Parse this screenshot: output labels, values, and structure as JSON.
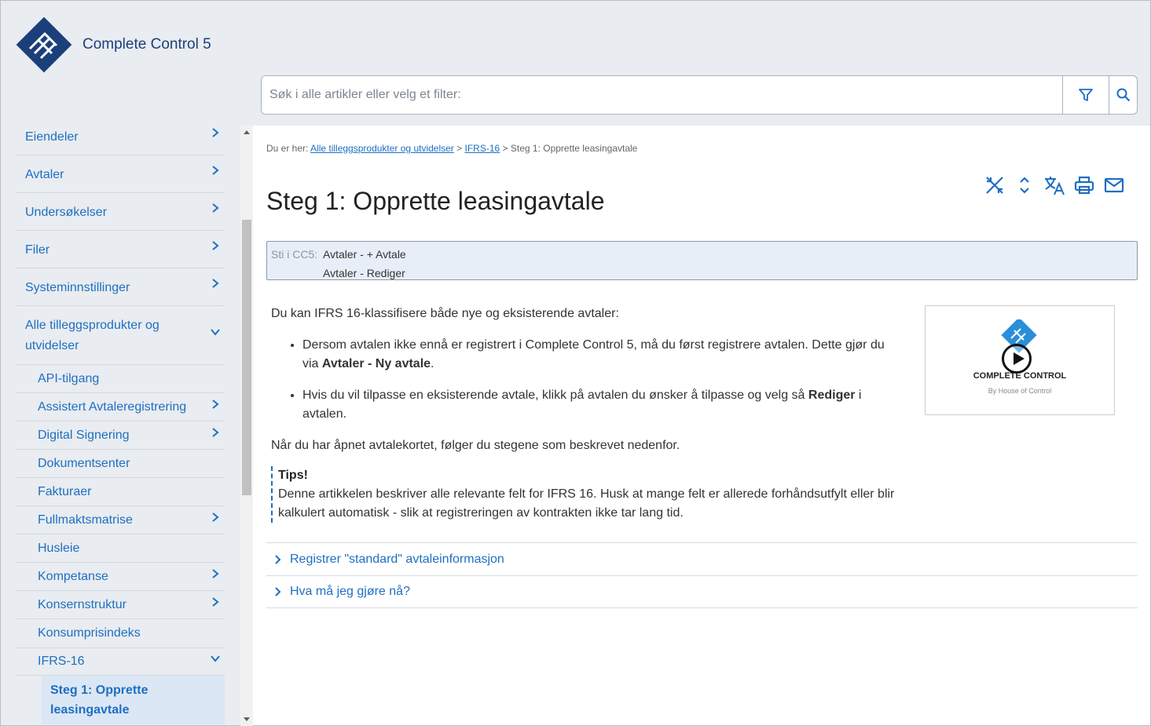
{
  "app": {
    "title": "Complete Control 5"
  },
  "search": {
    "placeholder": "Søk i alle artikler eller velg et filter:"
  },
  "sidebar": {
    "items": [
      {
        "label": "Eiendeler"
      },
      {
        "label": "Avtaler"
      },
      {
        "label": "Undersøkelser"
      },
      {
        "label": "Filer"
      },
      {
        "label": "Systeminnstillinger"
      },
      {
        "label": "Alle tilleggsprodukter og utvidelser"
      },
      {
        "label": "API-tilgang"
      },
      {
        "label": "Assistert Avtaleregistrering"
      },
      {
        "label": "Digital Signering"
      },
      {
        "label": "Dokumentsenter"
      },
      {
        "label": "Fakturaer"
      },
      {
        "label": "Fullmaktsmatrise"
      },
      {
        "label": "Husleie"
      },
      {
        "label": "Kompetanse"
      },
      {
        "label": "Konsernstruktur"
      },
      {
        "label": "Konsumprisindeks"
      },
      {
        "label": "IFRS-16"
      },
      {
        "label": "Steg 1: Opprette leasingavtale"
      }
    ]
  },
  "breadcrumb": {
    "prefix": "Du er her:",
    "link1": "Alle tilleggsprodukter og utvidelser",
    "sep": ">",
    "link2": "IFRS-16",
    "current": "Steg 1: Opprette leasingavtale"
  },
  "page": {
    "title": "Steg 1: Opprette leasingavtale"
  },
  "path_box": {
    "label": "Sti i CC5:",
    "line1": "Avtaler - + Avtale",
    "line2": "Avtaler - Rediger"
  },
  "content": {
    "intro": "Du kan IFRS 16-klassifisere både nye og eksisterende avtaler:",
    "bullet1_pre": "Dersom avtalen ikke ennå er registrert i Complete Control 5, må du først registrere avtalen. Dette gjør du via ",
    "bullet1_bold": "Avtaler - Ny avtale",
    "bullet1_post": ".",
    "bullet2_pre": "Hvis du vil tilpasse en eksisterende avtale, klikk på avtalen du ønsker å tilpasse og velg så ",
    "bullet2_bold": "Rediger",
    "bullet2_post": " i avtalen.",
    "after": "Når du har åpnet avtalekortet, følger du stegene som beskrevet nedenfor.",
    "tips_title": "Tips!",
    "tips_text": "Denne artikkelen beskriver alle relevante felt for IFRS 16. Husk at mange felt er allerede forhåndsutfylt eller blir kalkulert automatisk - slik at registreringen av kontrakten ikke tar lang tid."
  },
  "video": {
    "title": "COMPLETE CONTROL",
    "subtitle": "By House of Control"
  },
  "accordion": [
    {
      "label": "Registrer \"standard\" avtaleinformasjon"
    },
    {
      "label": "Hva må jeg gjøre nå?"
    }
  ],
  "colors": {
    "brand": "#1b3f7a",
    "link": "#1e6fc2",
    "background": "#e9ecf0"
  },
  "icons": [
    "filter-icon",
    "search-icon",
    "collapse-all-icon",
    "expand-icon",
    "translate-icon",
    "print-icon",
    "email-icon",
    "chevron-right-icon",
    "chevron-down-icon",
    "play-icon"
  ]
}
